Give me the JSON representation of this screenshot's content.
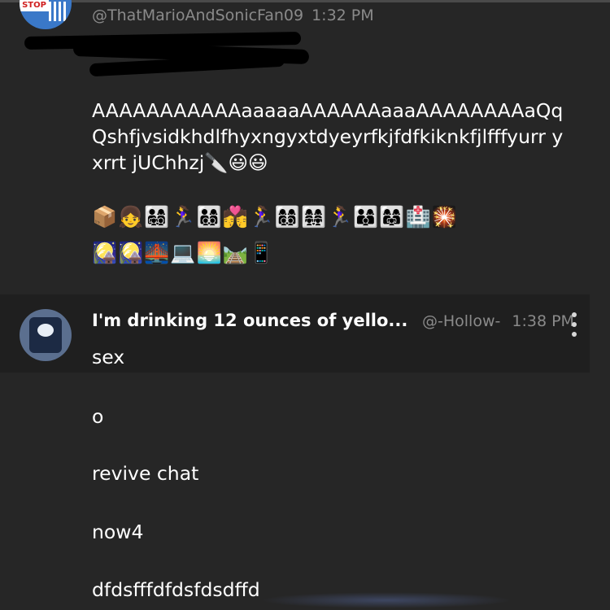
{
  "message1": {
    "handle": "@ThatMarioAndSonicFan09",
    "time": "1:32 PM",
    "avatar_badge": "STOP",
    "body": "AAAAAAAAAAAaaaaaAAAAAAaaaAAAAAAAAaQqQshfjvsidkhdlfhyxngyxtdyeyrfkjfdfkiknkfjlfffyurr yxrrt jUChhzj",
    "emoji_line1": "🔪😃😃",
    "emoji_line2": "📦👧👨‍👩‍👧‍👦🏃‍♀️👨‍👩‍👦‍👦💏🏃‍♀️👩‍👩‍👦‍👦👩‍👩‍👧‍👧🏃‍♀️👨‍👩‍👦👩‍👩‍👧🏥🎇",
    "emoji_line3": "🎑🎑🌉💻🌅🛤️📱"
  },
  "message2": {
    "author": "I'm drinking 12 ounces of yello...",
    "handle": "@-Hollow-",
    "time": "1:38 PM",
    "lines": [
      "sex",
      "o",
      "revive chat",
      "now4",
      "dfdsfffdfdsfdsdffd"
    ]
  }
}
